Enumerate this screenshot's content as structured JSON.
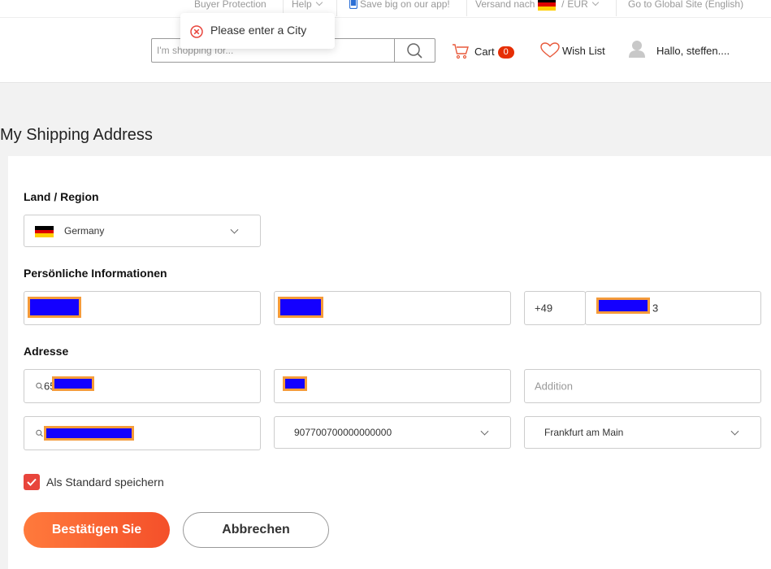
{
  "topbar": {
    "buyer_protection": "Buyer Protection",
    "help": "Help",
    "app_promo": "Save big on our app!",
    "ship_to": "Versand nach",
    "currency_sep": "/",
    "currency": "EUR",
    "global_site": "Go to Global Site (English)"
  },
  "toast": {
    "message": "Please enter a City",
    "icon": "error-circle-icon"
  },
  "header": {
    "search_placeholder": "I'm shopping for...",
    "cart_label": "Cart",
    "cart_count": "0",
    "wishlist_label": "Wish List",
    "greeting": "Hallo, steffen...."
  },
  "page": {
    "title": "My Shipping Address",
    "country_section": "Land / Region",
    "country": "Germany",
    "personal_section": "Persönliche Informationen",
    "phone_prefix": "+49",
    "phone_suffix": "3",
    "address_section": "Adresse",
    "street_prefix": "65",
    "addition_placeholder": "Addition",
    "province": "907700700000000000",
    "city": "Frankfurt am Main",
    "save_default": "Als Standard speichern",
    "confirm_button": "Bestätigen Sie",
    "cancel_button": "Abbrechen"
  },
  "colors": {
    "accent": "#f4502a",
    "badge": "#e62e04",
    "checkbox": "#e8453c",
    "redaction_fill": "#1400ff",
    "redaction_border": "#f59b3a"
  }
}
